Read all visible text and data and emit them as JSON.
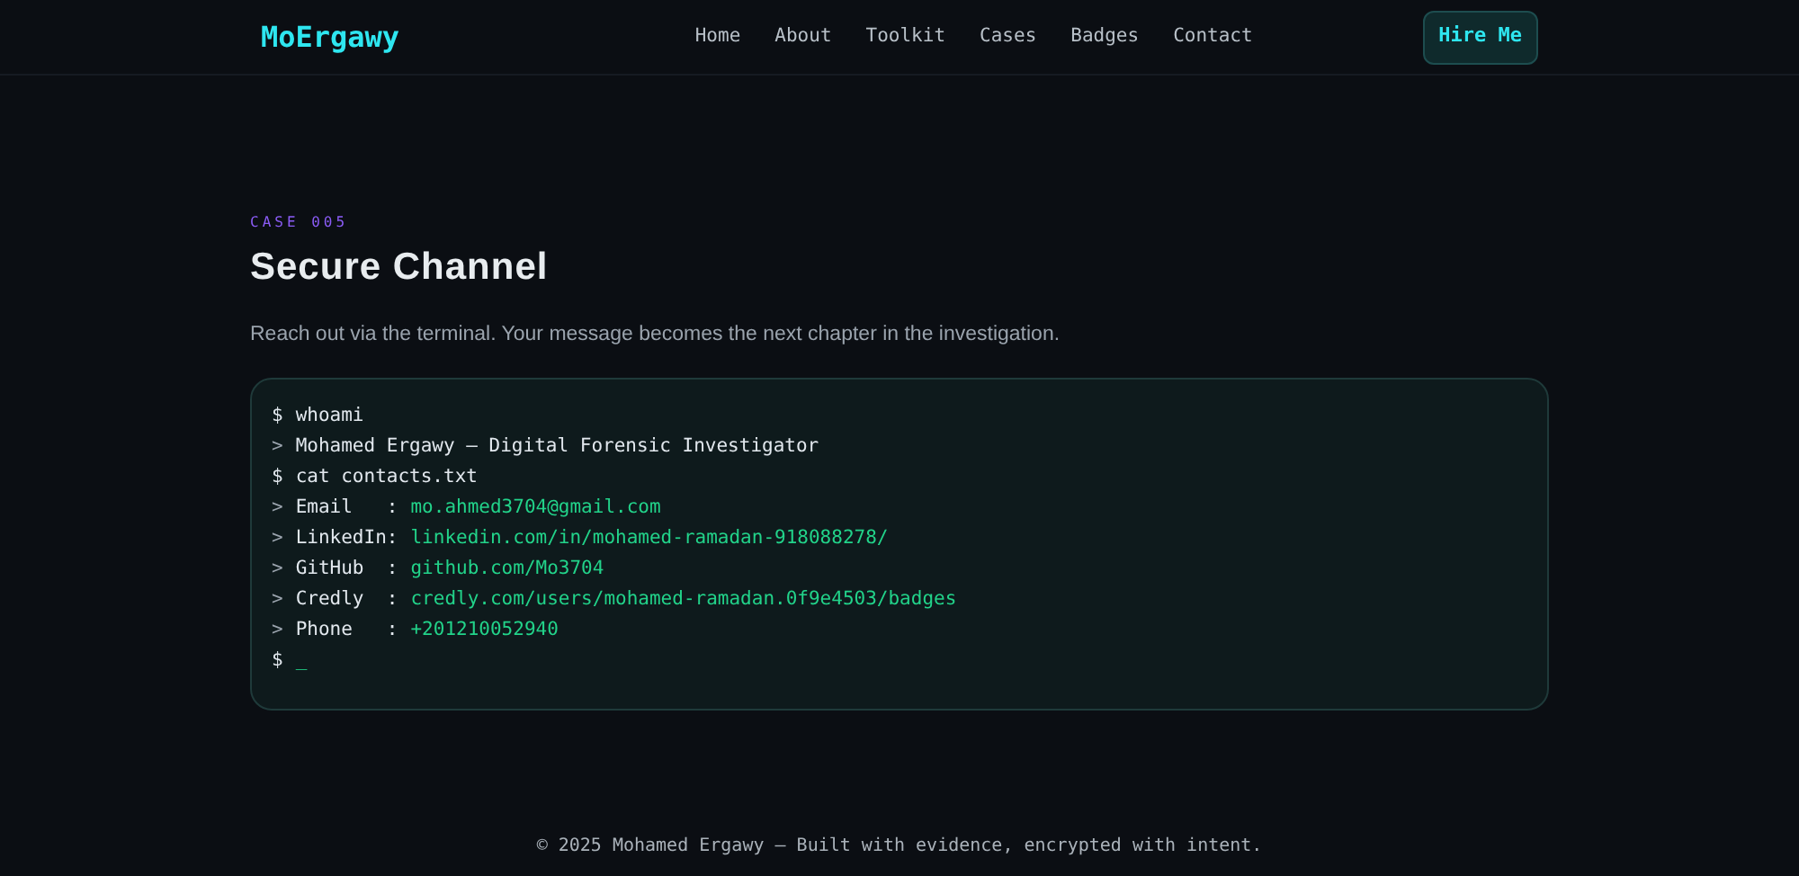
{
  "brand": "MoErgawy",
  "nav": [
    {
      "label": "Home"
    },
    {
      "label": "About"
    },
    {
      "label": "Toolkit"
    },
    {
      "label": "Cases"
    },
    {
      "label": "Badges"
    },
    {
      "label": "Contact"
    }
  ],
  "hire_button": "Hire Me",
  "section": {
    "eyebrow": "CASE 005",
    "title": "Secure Channel",
    "intro": "Reach out via the terminal. Your message becomes the next chapter in the investigation."
  },
  "terminal": [
    {
      "kind": "command",
      "prefix": "$",
      "text": "whoami"
    },
    {
      "kind": "output",
      "prefix": ">",
      "text": "Mohamed Ergawy — Digital Forensic Investigator"
    },
    {
      "kind": "command",
      "prefix": "$",
      "text": "cat contacts.txt"
    },
    {
      "kind": "contact",
      "prefix": ">",
      "label": "Email   :",
      "value": "mo.ahmed3704@gmail.com"
    },
    {
      "kind": "contact",
      "prefix": ">",
      "label": "LinkedIn:",
      "value": "linkedin.com/in/mohamed-ramadan-918088278/"
    },
    {
      "kind": "contact",
      "prefix": ">",
      "label": "GitHub  :",
      "value": "github.com/Mo3704"
    },
    {
      "kind": "contact",
      "prefix": ">",
      "label": "Credly  :",
      "value": "credly.com/users/mohamed-ramadan.0f9e4503/badges"
    },
    {
      "kind": "contact",
      "prefix": ">",
      "label": "Phone   :",
      "value": "+201210052940"
    },
    {
      "kind": "prompt",
      "prefix": "$",
      "cursor": "_"
    }
  ],
  "footer": "© 2025 Mohamed Ergawy — Built with evidence, encrypted with intent."
}
